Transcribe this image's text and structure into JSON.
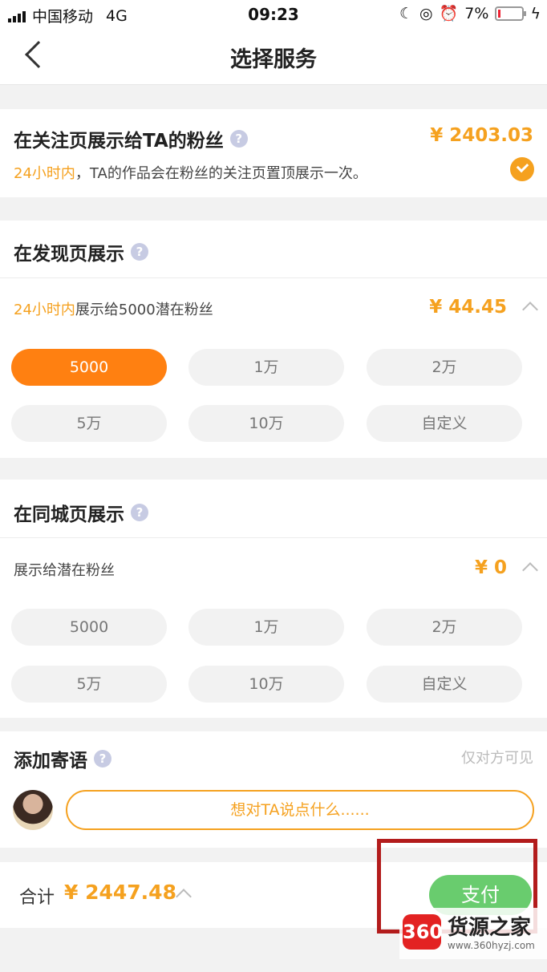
{
  "status_bar": {
    "carrier": "中国移动",
    "network": "4G",
    "time": "09:23",
    "battery": "7%"
  },
  "nav": {
    "title": "选择服务"
  },
  "follow_section": {
    "title": "在关注页展示给TA的粉丝",
    "help": "?",
    "price": "¥ 2403.03",
    "desc_highlight": "24小时内",
    "desc_rest": "，TA的作品会在粉丝的关注页置顶展示一次。",
    "selected": true
  },
  "discover_section": {
    "title": "在发现页展示",
    "help": "?",
    "sub_highlight": "24小时内",
    "sub_rest": "展示给5000潜在粉丝",
    "price": "¥ 44.45",
    "options": [
      "5000",
      "1万",
      "2万",
      "5万",
      "10万",
      "自定义"
    ],
    "selected_index": 0
  },
  "city_section": {
    "title": "在同城页展示",
    "help": "?",
    "sub": "展示给潜在粉丝",
    "price": "¥ 0",
    "options": [
      "5000",
      "1万",
      "2万",
      "5万",
      "10万",
      "自定义"
    ]
  },
  "message_section": {
    "title": "添加寄语",
    "help": "?",
    "visibility": "仅对方可见",
    "placeholder": "想对TA说点什么......"
  },
  "bottom": {
    "total_label": "合计",
    "total_price": "¥ 2447.48",
    "pay_label": "支付"
  },
  "watermark": {
    "logo": "360",
    "name": "货源之家",
    "url": "www.360hyzj.com"
  },
  "colors": {
    "accent": "#f5a11f",
    "active_pill": "#ff8011",
    "pay": "#69cc6e",
    "highlight_box": "#b31c1c"
  }
}
